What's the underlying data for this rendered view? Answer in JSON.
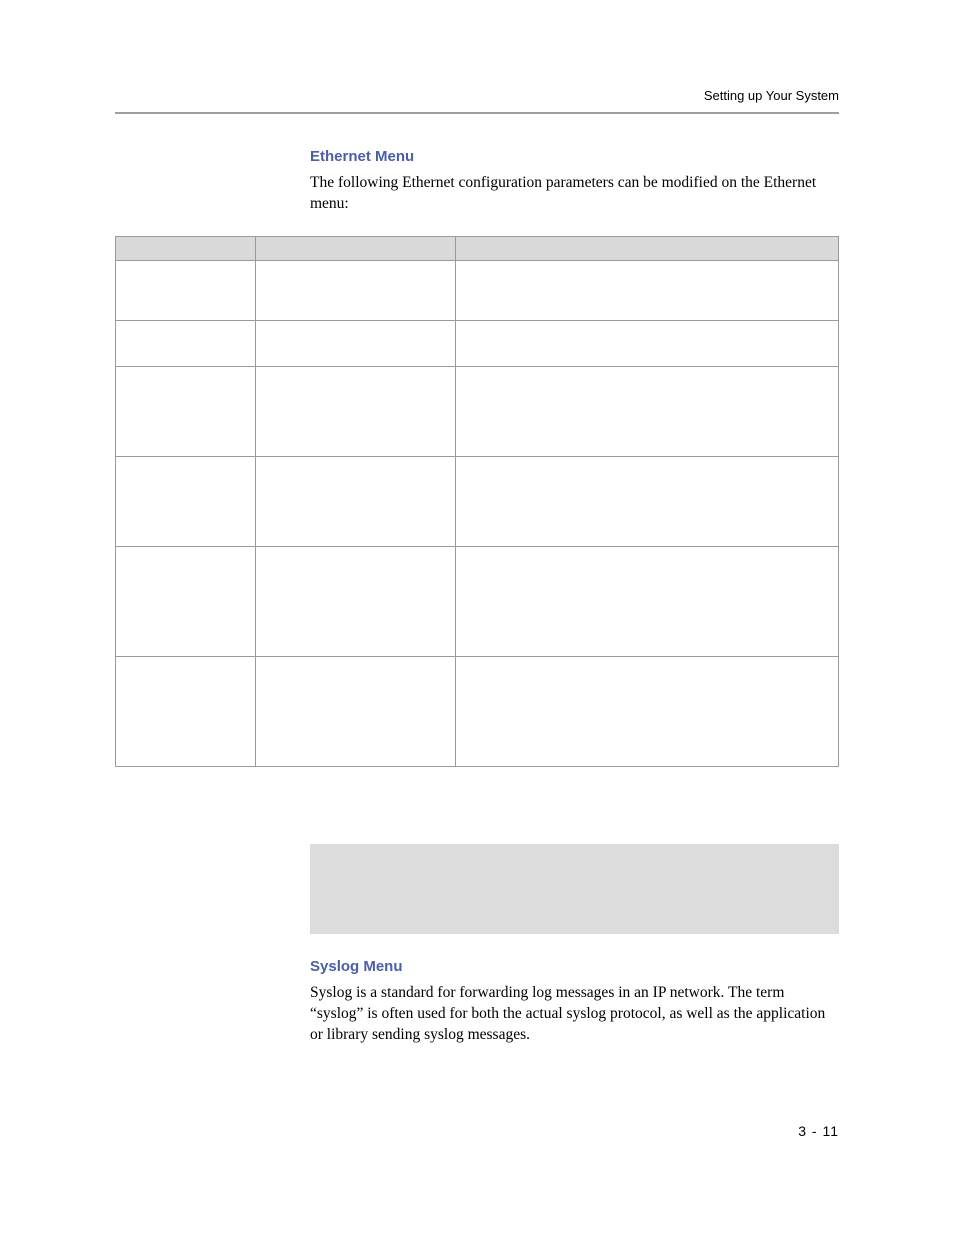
{
  "header": {
    "running": "Setting up Your System"
  },
  "section1": {
    "heading": "Ethernet Menu",
    "paragraph": "The following Ethernet configuration parameters can be modified on the Ethernet menu:"
  },
  "table": {
    "headers": [
      "",
      "",
      ""
    ],
    "rows": [
      [
        "",
        "",
        ""
      ],
      [
        "",
        "",
        ""
      ],
      [
        "",
        "",
        ""
      ],
      [
        "",
        "",
        ""
      ],
      [
        "",
        "",
        ""
      ],
      [
        "",
        "",
        ""
      ]
    ]
  },
  "note": {
    "text": ""
  },
  "section2": {
    "heading": "Syslog Menu",
    "paragraph": "Syslog is a standard for forwarding log messages in an IP network. The term “syslog” is often used for both the actual syslog protocol, as well as the application or library sending syslog messages."
  },
  "footer": {
    "page_number": "3 - 11"
  }
}
